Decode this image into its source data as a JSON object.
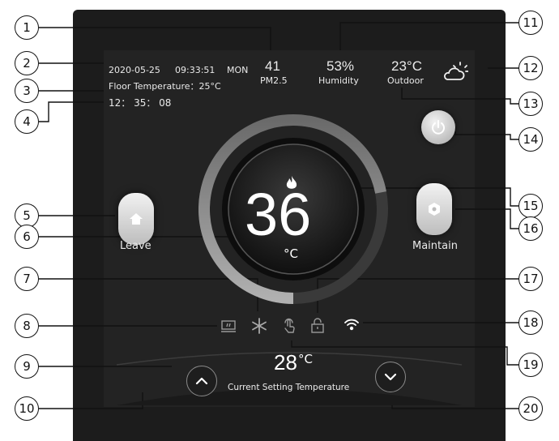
{
  "status_bar": {
    "date": "2020-05-25",
    "time": "09:33:51",
    "weekday": "MON",
    "floor_temperature": "Floor Temperature：25°C",
    "clock": "12： 35： 08"
  },
  "environment": {
    "pm25_value": "41",
    "pm25_label": "PM2.5",
    "humidity_value": "53%",
    "humidity_label": "Humidity",
    "outdoor_value": "23°C",
    "outdoor_label": "Outdoor",
    "weather_icon": "partly-cloudy-icon"
  },
  "dial": {
    "current_temperature": "36",
    "unit": "°C",
    "mode_icon": "flame-icon",
    "arc_fill_fraction": 0.72
  },
  "modes": {
    "leave_label": "Leave",
    "leave_icon": "home-icon",
    "maintain_label": "Maintain",
    "maintain_icon": "hexagon-icon"
  },
  "status_icons": [
    "window-icon",
    "snowflake-icon",
    "touch-icon",
    "lock-icon",
    "wifi-icon"
  ],
  "setting": {
    "temperature": "28",
    "unit": "°C",
    "label": "Current Setting Temperature"
  },
  "callouts": [
    "1",
    "2",
    "3",
    "4",
    "5",
    "6",
    "7",
    "8",
    "9",
    "10",
    "11",
    "12",
    "13",
    "14",
    "15",
    "16",
    "17",
    "18",
    "19",
    "20"
  ],
  "colors": {
    "panel": "#1c1c1c",
    "screen": "#232323",
    "text": "#eaeaea",
    "arc": "#8c8c8c",
    "arc_track": "#3a3a3a",
    "button_light": "#f2f2f2"
  }
}
